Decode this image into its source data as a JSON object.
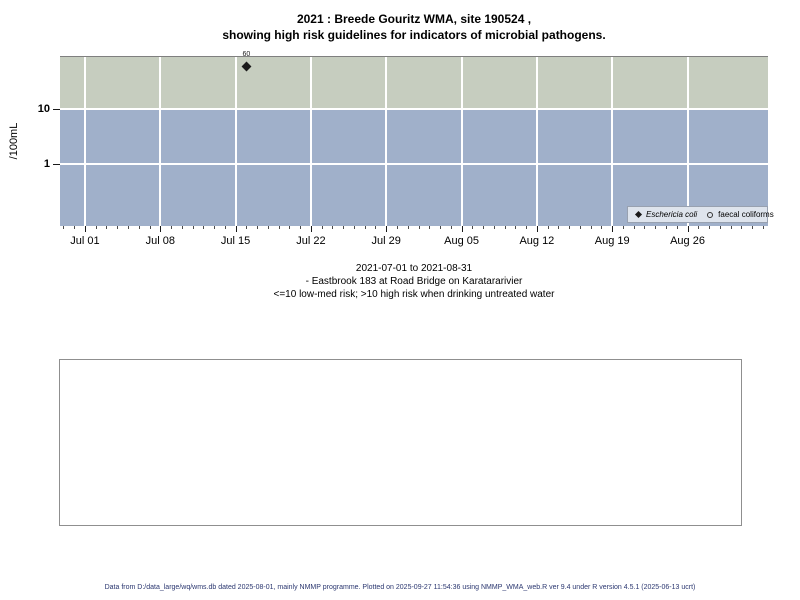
{
  "title": {
    "line1": "2021 : Breede Gouritz WMA, site 190524 ,",
    "line2": "showing high risk guidelines for indicators of microbial pathogens."
  },
  "chart_data": {
    "type": "scatter",
    "title": "2021 : Breede Gouritz WMA, site 190524 , showing high risk guidelines for indicators of microbial pathogens.",
    "ylabel": "/100mL",
    "y_scale": "log",
    "ylim": [
      0.075,
      88
    ],
    "y_ticks": [
      {
        "label": "10",
        "value": 10
      },
      {
        "label": "1",
        "value": 1
      }
    ],
    "x_start": "2021-07-01",
    "x_end": "2021-08-31",
    "x_ticks": [
      "Jul 01",
      "Jul 08",
      "Jul 15",
      "Jul 22",
      "Jul 29",
      "Aug 05",
      "Aug 12",
      "Aug 19",
      "Aug 26"
    ],
    "x_minor_tick_days": [
      -2,
      63
    ],
    "grid": "on",
    "bands": [
      {
        "name": "high risk zone (>10)",
        "from": 10,
        "to": 88,
        "color": "#c6cdbf"
      },
      {
        "name": "low-med risk zone (<=10)",
        "from": 0.075,
        "to": 10,
        "color": "#a0b0ca"
      }
    ],
    "series": [
      {
        "name": "Eschericia coli",
        "symbol": "filled-diamond",
        "points": [
          {
            "date": "2021-07-16",
            "value": 60,
            "label": "60"
          }
        ]
      },
      {
        "name": "faecal coliforms",
        "symbol": "open-circle",
        "points": []
      }
    ],
    "legend_position": "bottom-right"
  },
  "caption": {
    "line1": "2021-07-01 to 2021-08-31",
    "line2": "- Eastbrook 183 at Road Bridge on Karatararivier",
    "line3": "<=10 low-med risk; >10 high risk when drinking untreated water"
  },
  "footer": "Data from D:/data_large/wq/wms.db dated 2025-08-01, mainly NMMP programme. Plotted on 2025-09-27 11:54:36 using NMMP_WMA_web.R ver 9.4 under R version 4.5.1 (2025-06-13 ucrt)",
  "colors": {
    "band_high": "#c6cdbf",
    "band_low": "#a0b0ca",
    "grid": "#ffffff",
    "legend_bg": "#dee4ed",
    "legend_border": "#98a1b0",
    "footer_text": "#2b3770",
    "point": "#1a1a1a"
  }
}
